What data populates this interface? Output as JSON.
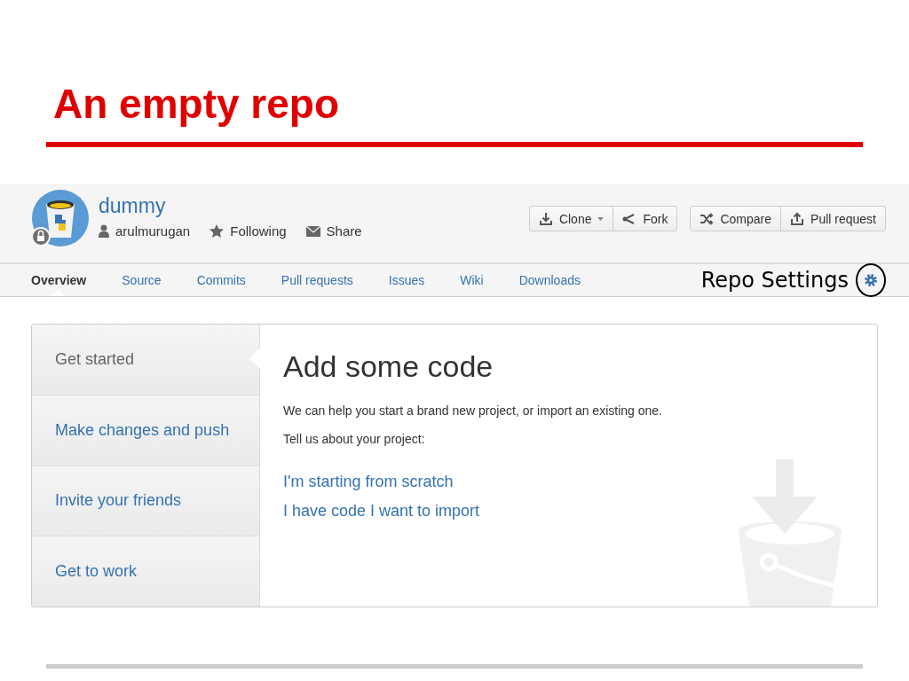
{
  "slide": {
    "title": "An empty repo"
  },
  "repo": {
    "name": "dummy",
    "owner": "arulmurugan",
    "follow": "Following",
    "share": "Share",
    "private": true
  },
  "actions": [
    {
      "label": "Clone",
      "kind": "clone"
    },
    {
      "label": "Fork",
      "kind": "fork"
    },
    {
      "label": "Compare",
      "kind": "compare"
    },
    {
      "label": "Pull request",
      "kind": "pull"
    }
  ],
  "tabs": [
    {
      "label": "Overview",
      "selected": true
    },
    {
      "label": "Source",
      "selected": false
    },
    {
      "label": "Commits",
      "selected": false
    },
    {
      "label": "Pull requests",
      "selected": false
    },
    {
      "label": "Issues",
      "selected": false
    },
    {
      "label": "Wiki",
      "selected": false
    },
    {
      "label": "Downloads",
      "selected": false
    }
  ],
  "annotation": {
    "text": "Repo Settings"
  },
  "steps": [
    {
      "label": "Get started",
      "selected": true
    },
    {
      "label": "Make changes and push",
      "selected": false
    },
    {
      "label": "Invite your friends",
      "selected": false
    },
    {
      "label": "Get to work",
      "selected": false
    }
  ],
  "panel": {
    "heading": "Add some code",
    "intro": "We can help you start a brand new project, or import an existing one.",
    "prompt": "Tell us about your project:",
    "links": [
      "I'm starting from scratch",
      "I have code I want to import"
    ]
  }
}
